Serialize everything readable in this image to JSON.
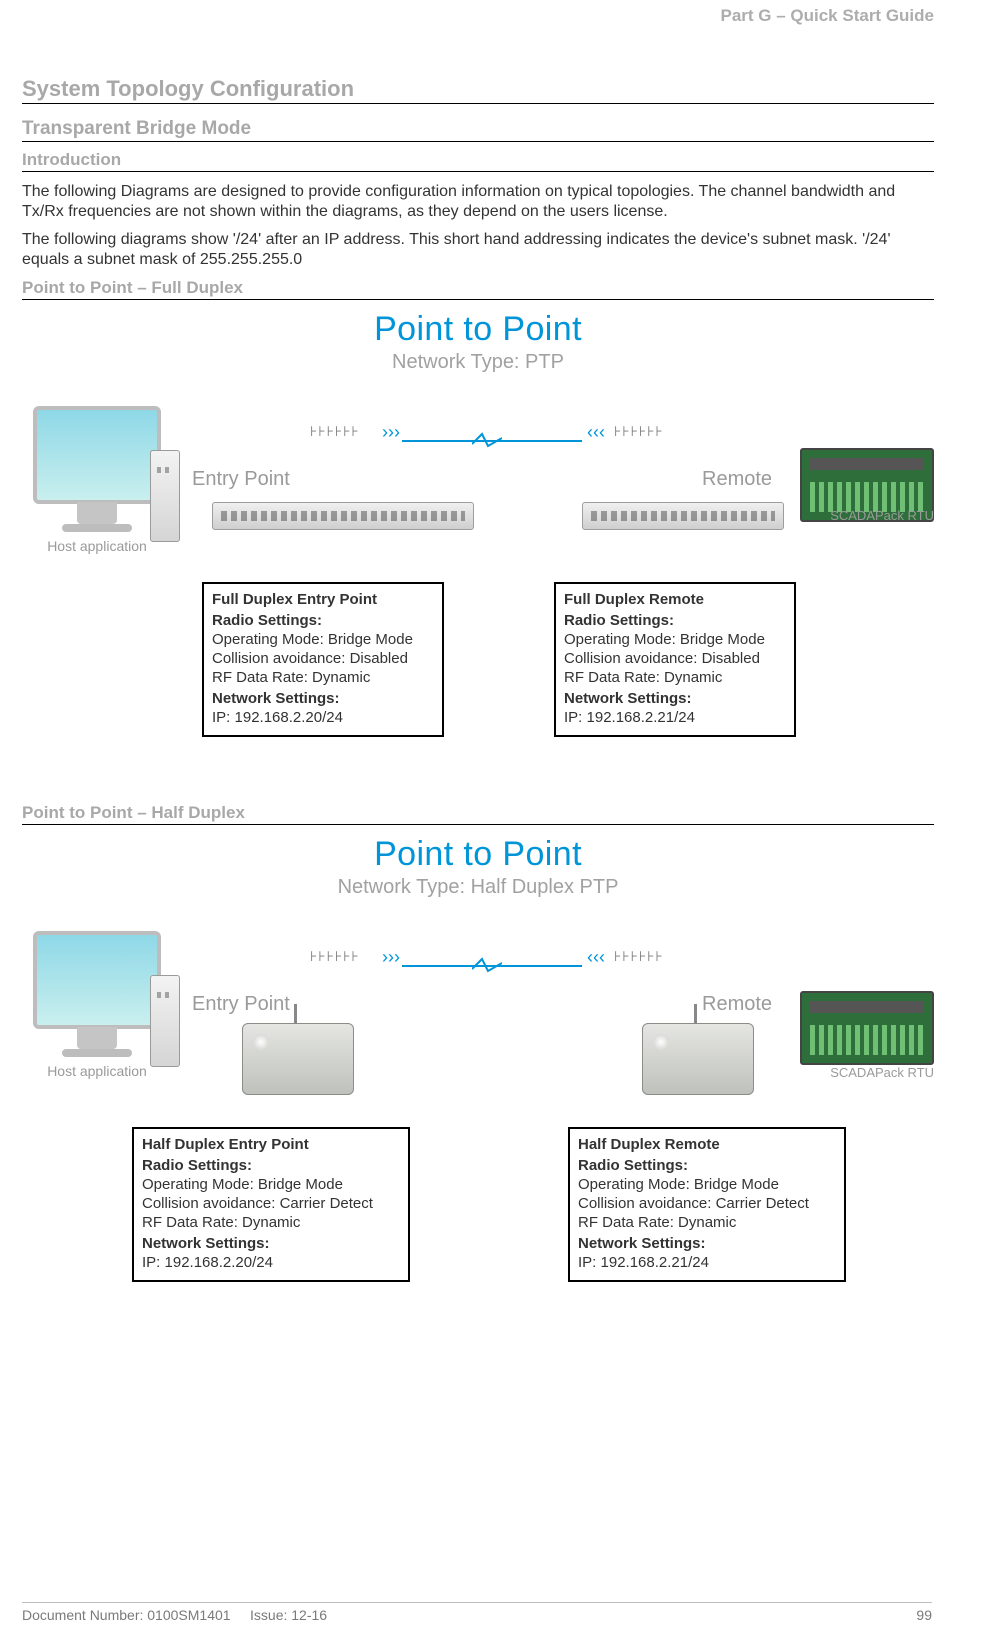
{
  "header": {
    "part": "Part G – Quick Start Guide"
  },
  "headings": {
    "h1": "System Topology Configuration",
    "h2": "Transparent Bridge Mode",
    "h3": "Introduction",
    "ptp_full": "Point to Point – Full Duplex",
    "ptp_half": "Point to Point – Half Duplex"
  },
  "paragraphs": {
    "p1": "The following Diagrams are designed to provide configuration information on typical topologies. The channel bandwidth and Tx/Rx frequencies are not shown within the diagrams, as they depend on the users license.",
    "p2": "The following diagrams show '/24' after an IP address. This short hand addressing indicates the device's subnet mask. '/24' equals a subnet mask of 255.255.255.0"
  },
  "diag_full": {
    "title": "Point to Point",
    "subtitle": "Network Type: PTP",
    "host_label": "Host application",
    "entry_label": "Entry Point",
    "remote_label": "Remote",
    "scada_label": "SCADAPack RTU",
    "entry_box": {
      "title": "Full Duplex Entry Point",
      "rs_head": "Radio Settings:",
      "rs1": "Operating Mode: Bridge Mode",
      "rs2": "Collision avoidance: Disabled",
      "rs3": "RF Data Rate: Dynamic",
      "ns_head": "Network Settings:",
      "ns1": "IP: 192.168.2.20/24"
    },
    "remote_box": {
      "title": "Full Duplex Remote",
      "rs_head": "Radio Settings:",
      "rs1": "Operating Mode: Bridge Mode",
      "rs2": "Collision avoidance: Disabled",
      "rs3": "RF Data Rate: Dynamic",
      "ns_head": "Network Settings:",
      "ns1": "IP: 192.168.2.21/24"
    }
  },
  "diag_half": {
    "title": "Point to Point",
    "subtitle": "Network Type: Half Duplex PTP",
    "host_label": "Host application",
    "entry_label": "Entry Point",
    "remote_label": "Remote",
    "scada_label": "SCADAPack RTU",
    "entry_box": {
      "title": "Half Duplex Entry Point",
      "rs_head": "Radio Settings:",
      "rs1": "Operating Mode: Bridge Mode",
      "rs2": "Collision avoidance: Carrier Detect",
      "rs3": "RF Data Rate: Dynamic",
      "ns_head": "Network Settings:",
      "ns1": "IP: 192.168.2.20/24"
    },
    "remote_box": {
      "title": "Half Duplex Remote",
      "rs_head": "Radio Settings:",
      "rs1": "Operating Mode: Bridge Mode",
      "rs2": "Collision avoidance: Carrier Detect",
      "rs3": "RF Data Rate: Dynamic",
      "ns_head": "Network Settings:",
      "ns1": "IP: 192.168.2.21/24"
    }
  },
  "footer": {
    "doc": "Document Number: 0100SM1401",
    "issue": "Issue: 12-16",
    "page": "99"
  },
  "icons": {
    "ant_right": "⊦⊦⊦⊦⊦⊦",
    "ant_left": "⊦⊦⊦⊦⊦⊦",
    "wave": "𝄙"
  }
}
